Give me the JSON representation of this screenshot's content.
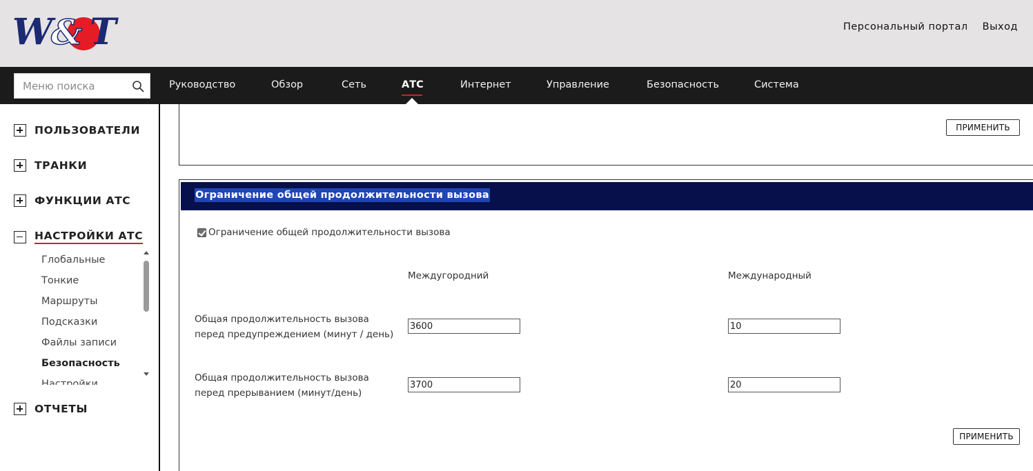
{
  "header": {
    "logo_text": "W&T",
    "links": [
      "Персональный портал",
      "Выход"
    ],
    "colors": {
      "logo_blue": "#1c2a73",
      "logo_red": "#e31c25"
    }
  },
  "nav": {
    "search_placeholder": "Меню поиска",
    "items": [
      "Руководство",
      "Обзор",
      "Сеть",
      "АТС",
      "Интернет",
      "Управление",
      "Безопасность",
      "Система"
    ],
    "active": "АТС"
  },
  "sidebar": {
    "sections": [
      "ПОЛЬЗОВАТЕЛИ",
      "ТРАНКИ",
      "ФУНКЦИИ АТС",
      "НАСТРОЙКИ АТС",
      "ОТЧЕТЫ"
    ],
    "expanded": "НАСТРОЙКИ АТС",
    "sub_items": [
      "Глобальные",
      "Тонкие",
      "Маршруты",
      "Подсказки",
      "Файлы записи",
      "Безопасность",
      "Настройки"
    ],
    "current": "Безопасность"
  },
  "top_panel": {
    "apply_label": "ПРИМЕНИТЬ"
  },
  "call_limit": {
    "title": "Ограничение общей продолжительности вызова",
    "checkbox_label": "Ограничение общей продолжительности вызова",
    "checked": true,
    "col_long_distance": "Междугородний",
    "col_international": "Международный",
    "warning_label_1": "Общая продолжительность вызова",
    "warning_label_2": "перед предупреждением (минут / день)",
    "cutoff_label_1": "Общая продолжительность вызова",
    "cutoff_label_2": "перед прерыванием (минут/день)",
    "warning_long_distance": "3600",
    "warning_international": "10",
    "cutoff_long_distance": "3700",
    "cutoff_international": "20",
    "apply_label": "ПРИМЕНИТЬ",
    "header_color": "#07104a"
  }
}
